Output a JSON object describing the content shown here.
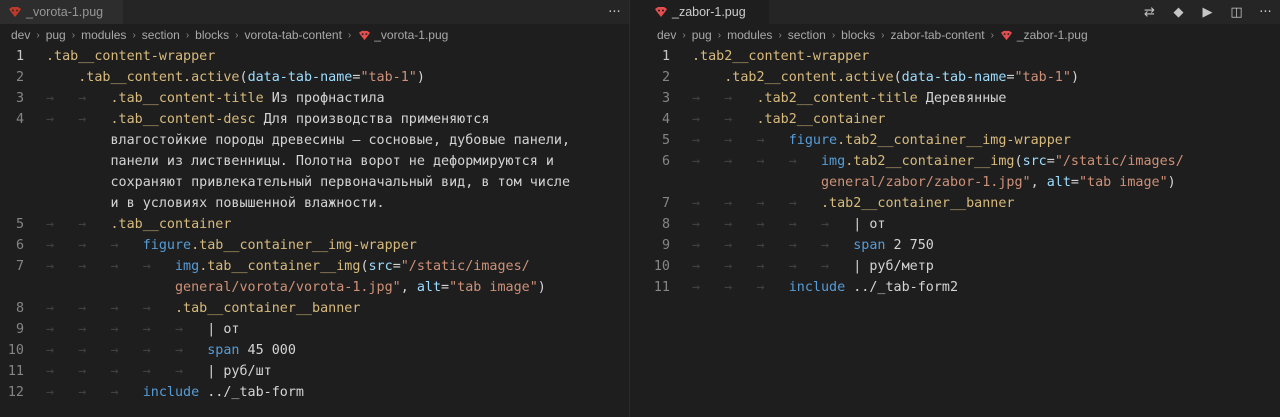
{
  "left": {
    "tab": {
      "label": "_vorota-1.pug",
      "more": "···"
    },
    "breadcrumb": [
      "dev",
      "pug",
      "modules",
      "section",
      "blocks",
      "vorota-tab-content"
    ],
    "breadcrumb_file": "_vorota-1.pug",
    "lines": [
      {
        "n": "1",
        "segs": [
          [
            "sel",
            ".tab__content-wrapper"
          ]
        ]
      },
      {
        "n": "2",
        "segs": [
          [
            "ws",
            "    "
          ],
          [
            "sel",
            ".tab__content.active"
          ],
          [
            "plain",
            "("
          ],
          [
            "attr",
            "data-tab-name"
          ],
          [
            "plain",
            "="
          ],
          [
            "str",
            "\"tab-1\""
          ],
          [
            "plain",
            ")"
          ]
        ]
      },
      {
        "n": "3",
        "segs": [
          [
            "ws",
            "→   →   "
          ],
          [
            "sel",
            ".tab__content-title"
          ],
          [
            "plain",
            " Из профнастила"
          ]
        ]
      },
      {
        "n": "4",
        "segs": [
          [
            "ws",
            "→   →   "
          ],
          [
            "sel",
            ".tab__content-desc"
          ],
          [
            "plain",
            " Для производства применяются"
          ]
        ]
      },
      {
        "n": "",
        "segs": [
          [
            "plain",
            "        влагостойкие породы древесины – сосновые, дубовые панели,"
          ]
        ]
      },
      {
        "n": "",
        "segs": [
          [
            "plain",
            "        панели из лиственницы. Полотна ворот не деформируются и"
          ]
        ]
      },
      {
        "n": "",
        "segs": [
          [
            "plain",
            "        сохраняют привлекательный первоначальный вид, в том числе"
          ]
        ]
      },
      {
        "n": "",
        "segs": [
          [
            "plain",
            "        и в условиях повышенной влажности."
          ]
        ]
      },
      {
        "n": "5",
        "segs": [
          [
            "ws",
            "→   →   "
          ],
          [
            "sel",
            ".tab__container"
          ]
        ]
      },
      {
        "n": "6",
        "segs": [
          [
            "ws",
            "→   →   →   "
          ],
          [
            "kw",
            "figure"
          ],
          [
            "sel",
            ".tab__container__img-wrapper"
          ]
        ]
      },
      {
        "n": "7",
        "segs": [
          [
            "ws",
            "→   →   →   →   "
          ],
          [
            "kw",
            "img"
          ],
          [
            "sel",
            ".tab__container__img"
          ],
          [
            "plain",
            "("
          ],
          [
            "attr",
            "src"
          ],
          [
            "plain",
            "="
          ],
          [
            "str",
            "\"/static/images/"
          ]
        ]
      },
      {
        "n": "",
        "segs": [
          [
            "str",
            "                general/vorota/vorota-1.jpg\""
          ],
          [
            "plain",
            ", "
          ],
          [
            "attr",
            "alt"
          ],
          [
            "plain",
            "="
          ],
          [
            "str",
            "\"tab image\""
          ],
          [
            "plain",
            ")"
          ]
        ]
      },
      {
        "n": "8",
        "segs": [
          [
            "ws",
            "→   →   →   →   "
          ],
          [
            "sel",
            ".tab__container__banner"
          ]
        ]
      },
      {
        "n": "9",
        "segs": [
          [
            "ws",
            "→   →   →   →   →   "
          ],
          [
            "pipe",
            "| от"
          ]
        ]
      },
      {
        "n": "10",
        "segs": [
          [
            "ws",
            "→   →   →   →   →   "
          ],
          [
            "kw",
            "span"
          ],
          [
            "plain",
            " 45 000"
          ]
        ]
      },
      {
        "n": "11",
        "segs": [
          [
            "ws",
            "→   →   →   →   →   "
          ],
          [
            "pipe",
            "| руб/шт"
          ]
        ]
      },
      {
        "n": "12",
        "segs": [
          [
            "ws",
            "→   →   →   "
          ],
          [
            "kw",
            "include"
          ],
          [
            "plain",
            " ../_tab-form"
          ]
        ]
      }
    ]
  },
  "right": {
    "tab": {
      "label": "_zabor-1.pug"
    },
    "actions": [
      "split-compare",
      "git-commit",
      "run",
      "split-editor",
      "more"
    ],
    "action_glyphs": {
      "split-compare": "⇄",
      "git-commit": "◆",
      "run": "▶",
      "split-editor": "◫",
      "more": "···"
    },
    "breadcrumb": [
      "dev",
      "pug",
      "modules",
      "section",
      "blocks",
      "zabor-tab-content"
    ],
    "breadcrumb_file": "_zabor-1.pug",
    "lines": [
      {
        "n": "1",
        "segs": [
          [
            "sel",
            ".tab2__content-wrapper"
          ]
        ]
      },
      {
        "n": "2",
        "segs": [
          [
            "ws",
            "    "
          ],
          [
            "sel",
            ".tab2__content.active"
          ],
          [
            "plain",
            "("
          ],
          [
            "attr",
            "data-tab-name"
          ],
          [
            "plain",
            "="
          ],
          [
            "str",
            "\"tab-1\""
          ],
          [
            "plain",
            ")"
          ]
        ]
      },
      {
        "n": "3",
        "segs": [
          [
            "ws",
            "→   →   "
          ],
          [
            "sel",
            ".tab2__content-title"
          ],
          [
            "plain",
            " Деревянные"
          ]
        ]
      },
      {
        "n": "4",
        "segs": [
          [
            "ws",
            "→   →   "
          ],
          [
            "sel",
            ".tab2__container"
          ]
        ]
      },
      {
        "n": "5",
        "segs": [
          [
            "ws",
            "→   →   →   "
          ],
          [
            "kw",
            "figure"
          ],
          [
            "sel",
            ".tab2__container__img-wrapper"
          ]
        ]
      },
      {
        "n": "6",
        "segs": [
          [
            "ws",
            "→   →   →   →   "
          ],
          [
            "kw",
            "img"
          ],
          [
            "sel",
            ".tab2__container__img"
          ],
          [
            "plain",
            "("
          ],
          [
            "attr",
            "src"
          ],
          [
            "plain",
            "="
          ],
          [
            "str",
            "\"/static/images/"
          ]
        ]
      },
      {
        "n": "",
        "segs": [
          [
            "str",
            "                general/zabor/zabor-1.jpg\""
          ],
          [
            "plain",
            ", "
          ],
          [
            "attr",
            "alt"
          ],
          [
            "plain",
            "="
          ],
          [
            "str",
            "\"tab image\""
          ],
          [
            "plain",
            ")"
          ]
        ]
      },
      {
        "n": "7",
        "segs": [
          [
            "ws",
            "→   →   →   →   "
          ],
          [
            "sel",
            ".tab2__container__banner"
          ]
        ]
      },
      {
        "n": "8",
        "segs": [
          [
            "ws",
            "→   →   →   →   →   "
          ],
          [
            "pipe",
            "| от"
          ]
        ]
      },
      {
        "n": "9",
        "segs": [
          [
            "ws",
            "→   →   →   →   →   "
          ],
          [
            "kw",
            "span"
          ],
          [
            "plain",
            " 2 750"
          ]
        ]
      },
      {
        "n": "10",
        "segs": [
          [
            "ws",
            "→   →   →   →   →   "
          ],
          [
            "pipe",
            "| руб/метр"
          ]
        ]
      },
      {
        "n": "11",
        "segs": [
          [
            "ws",
            "→   →   →   "
          ],
          [
            "kw",
            "include"
          ],
          [
            "plain",
            " ../_tab-form2"
          ]
        ]
      }
    ]
  },
  "colors": {
    "background": "#1e1e1e",
    "selector": "#d7ba7d",
    "keyword": "#569cd6",
    "attribute": "#9cdcfe",
    "string": "#ce9178",
    "text": "#d4d4d4",
    "line_number": "#858585",
    "pug_icon": "#e44d4d"
  }
}
